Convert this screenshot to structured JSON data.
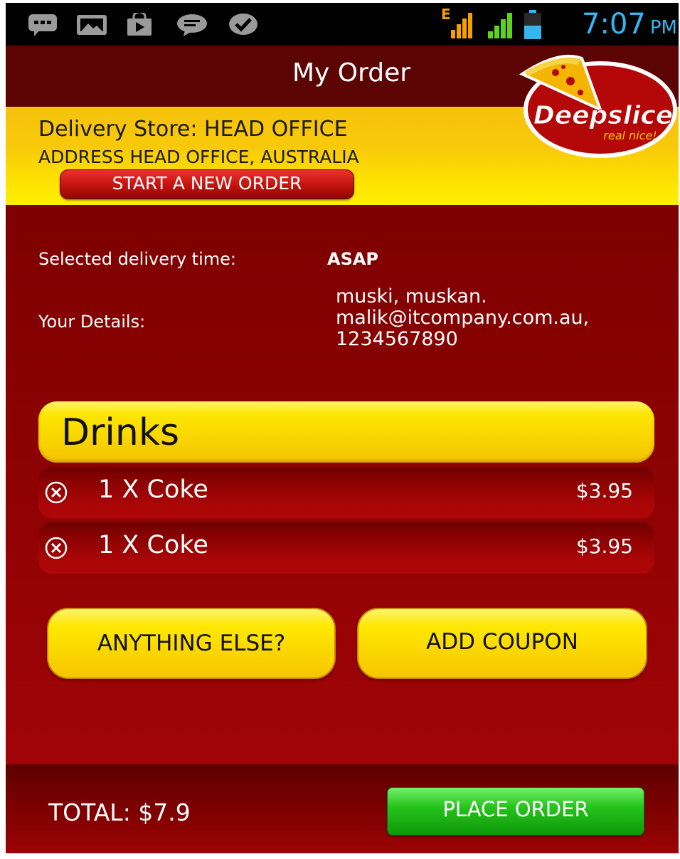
{
  "status_bar": {
    "time": "7:07",
    "ampm": "PM",
    "network_label": "E",
    "icons": [
      "chat-icon",
      "image-icon",
      "store-icon",
      "message-icon",
      "check-icon",
      "signal-icon",
      "signal-icon",
      "battery-icon"
    ]
  },
  "header": {
    "title": "My Order"
  },
  "logo": {
    "brand": "Deepslice",
    "tagline": "real nice!"
  },
  "store": {
    "name": "Delivery Store: HEAD OFFICE",
    "address": "ADDRESS HEAD OFFICE, AUSTRALIA",
    "new_order_label": "START A NEW ORDER"
  },
  "order_info": {
    "delivery_time_label": "Selected delivery time:",
    "delivery_time_value": "ASAP",
    "details_label": "Your Details:",
    "details_lines": [
      "muski, muskan.",
      "malik@itcompany.com.au,",
      "1234567890"
    ]
  },
  "category": {
    "name": "Drinks"
  },
  "items": [
    {
      "name": "1 X Coke",
      "price": "$3.95"
    },
    {
      "name": "1 X Coke",
      "price": "$3.95"
    }
  ],
  "buttons": {
    "anything_else": "ANYTHING ELSE?",
    "add_coupon": "ADD COUPON"
  },
  "footer": {
    "total": "TOTAL: $7.9",
    "place_order": "PLACE ORDER"
  },
  "colors": {
    "background_red": "#9c0406",
    "header_dark": "#5c0303",
    "yellow": "#fde100",
    "green_button": "#27c41d",
    "status_blue": "#35b6f0"
  }
}
